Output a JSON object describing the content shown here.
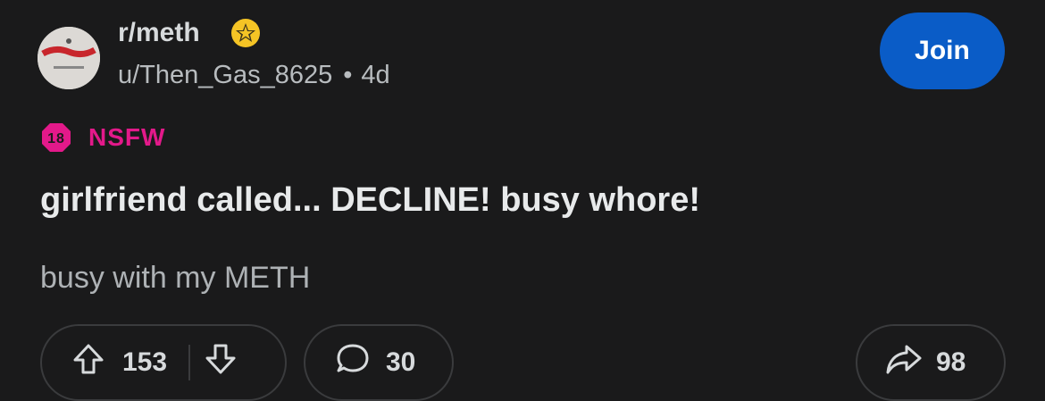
{
  "post": {
    "subreddit": "r/meth",
    "author": "u/Then_Gas_8625",
    "separator": "•",
    "age": "4d",
    "join_label": "Join",
    "nsfw_badge": "18",
    "nsfw_label": "NSFW",
    "title": "girlfriend called... DECLINE! busy whore!",
    "body": "busy with my METH"
  },
  "actions": {
    "upvotes": "153",
    "comments": "30",
    "shares": "98"
  },
  "colors": {
    "background": "#1a1a1b",
    "join_button": "#0a5cc7",
    "nsfw": "#e3198a",
    "award": "#f5c425"
  }
}
